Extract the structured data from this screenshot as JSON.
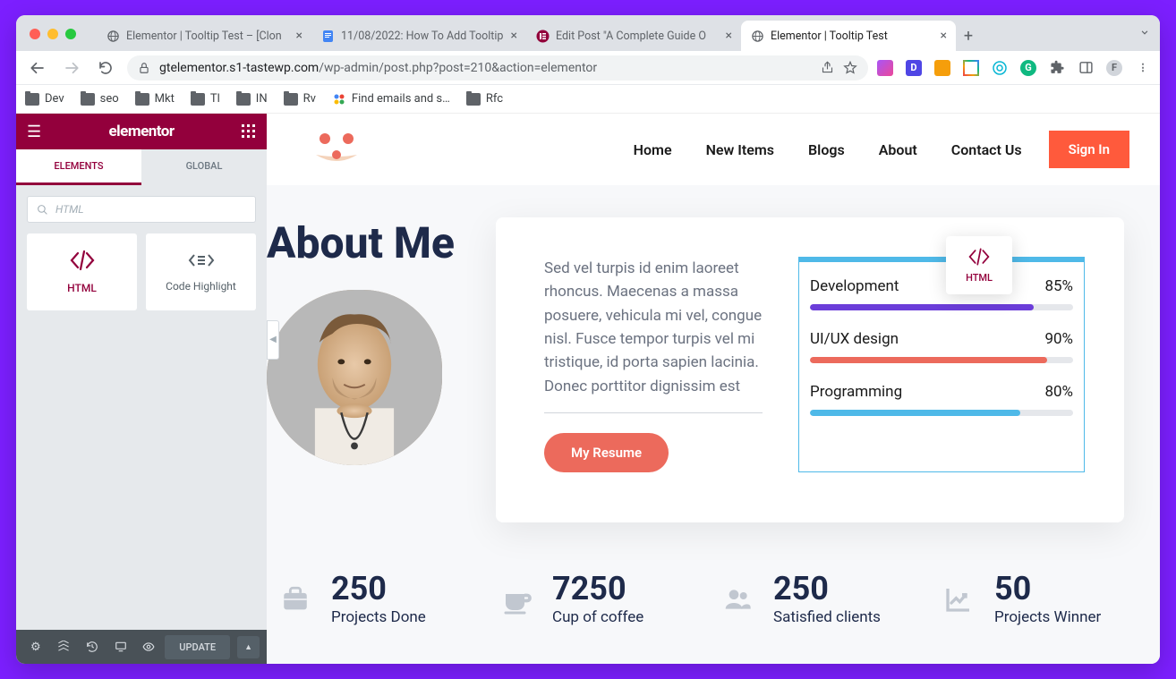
{
  "tabs": [
    {
      "title": "Elementor | Tooltip Test – [Clon",
      "icon": "globe"
    },
    {
      "title": "11/08/2022: How To Add Tooltip",
      "icon": "docs"
    },
    {
      "title": "Edit Post \"A Complete Guide O",
      "icon": "purple"
    },
    {
      "title": "Elementor | Tooltip Test",
      "icon": "globe",
      "active": true
    }
  ],
  "url": {
    "domain": "gtelementor.s1-tastewp.com",
    "path": "/wp-admin/post.php?post=210&action=elementor"
  },
  "bookmarks": [
    "Dev",
    "seo",
    "Mkt",
    "Tl",
    "IN",
    "Rv",
    "Find emails and s…",
    "Rfc"
  ],
  "elementor": {
    "logo": "elementor",
    "tabs": {
      "elements": "ELEMENTS",
      "global": "GLOBAL"
    },
    "search_placeholder": "HTML",
    "widgets": [
      {
        "label": "HTML",
        "icon": "code",
        "active": true
      },
      {
        "label": "Code Highlight",
        "icon": "code-highlight",
        "active": false
      }
    ],
    "update": "UPDATE"
  },
  "site": {
    "nav": [
      "Home",
      "New Items",
      "Blogs",
      "About",
      "Contact Us"
    ],
    "sign_in": "Sign In"
  },
  "about": {
    "title": "About Me",
    "para": "Sed vel turpis id enim laoreet rhoncus. Maecenas a massa posuere, vehicula mi vel, congue nisl. Fusce tempor turpis vel mi tristique, id porta sapien lacinia. Donec porttitor dignissim est",
    "resume": "My Resume",
    "tooltip_label": "HTML",
    "skills": [
      {
        "name": "Development",
        "pct": "85%",
        "color": "#6b3dd9",
        "width": "85%"
      },
      {
        "name": "UI/UX design",
        "pct": "90%",
        "color": "#ec6a5c",
        "width": "90%"
      },
      {
        "name": "Programming",
        "pct": "80%",
        "color": "#4fb9e8",
        "width": "80%"
      }
    ]
  },
  "stats": [
    {
      "num": "250",
      "label": "Projects Done",
      "icon": "briefcase"
    },
    {
      "num": "7250",
      "label": "Cup of coffee",
      "icon": "coffee"
    },
    {
      "num": "250",
      "label": "Satisfied clients",
      "icon": "users"
    },
    {
      "num": "50",
      "label": "Projects Winner",
      "icon": "chart"
    }
  ]
}
